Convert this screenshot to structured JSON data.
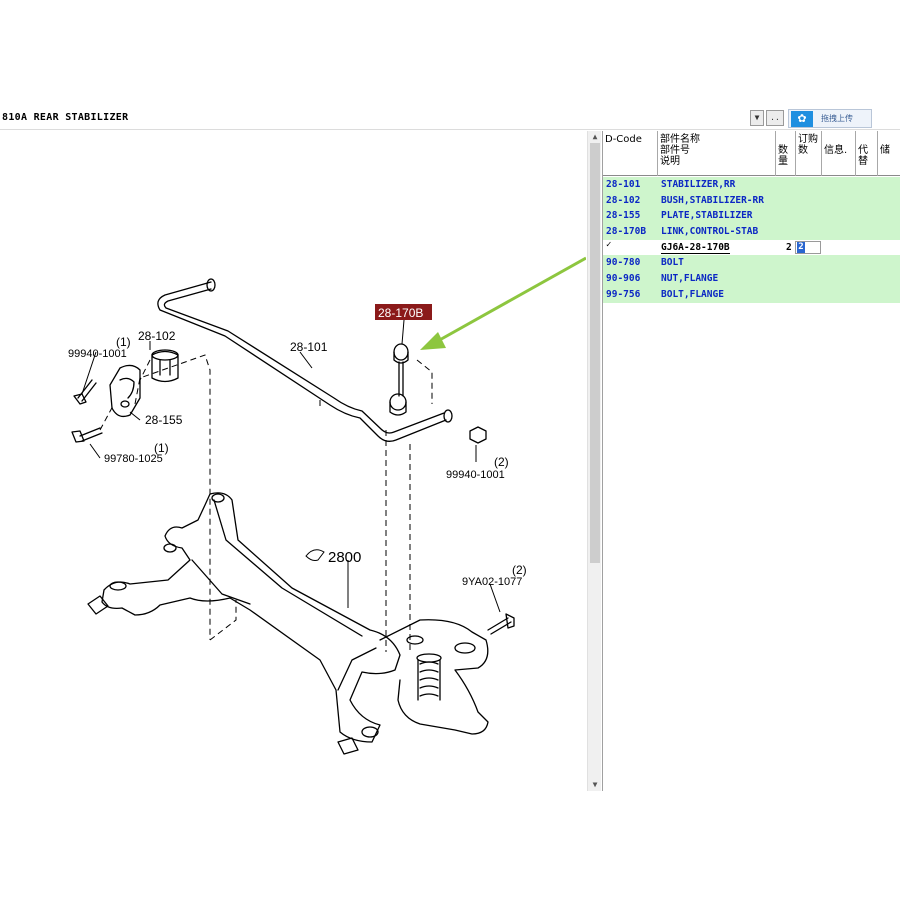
{
  "window": {
    "title": "810A  REAR STABILIZER",
    "upload_button_label": "拖拽上传",
    "upload_logo": "cloud-upload-icon"
  },
  "diagram": {
    "highlight_label": "28-170B",
    "labels": {
      "p28_102": "28-102",
      "p28_101": "28-101",
      "p28_155": "28-155",
      "p2800": "2800",
      "bolt_99940_left_qty": "(1)",
      "bolt_99940_left": "99940-1001",
      "bolt_99780_qty": "(1)",
      "bolt_99780": "99780-1025",
      "nut_99940_right_qty": "(2)",
      "nut_99940_right": "99940-1001",
      "bolt_9ya02_qty": "(2)",
      "bolt_9ya02": "9YA02-1077"
    }
  },
  "parts_table": {
    "headers": {
      "dcode": "D-Code",
      "name_l1": "部件名称",
      "name_l2": "部件号",
      "name_l3": "说明",
      "qty": "数量",
      "order_qty": "订购数",
      "info": "信息.",
      "replace": "代替",
      "extra": "储"
    },
    "rows": [
      {
        "code": "28-101",
        "name": "STABILIZER,RR"
      },
      {
        "code": "28-102",
        "name": "BUSH,STABILIZER-RR"
      },
      {
        "code": "28-155",
        "name": "PLATE,STABILIZER"
      },
      {
        "code": "28-170B",
        "name": "LINK,CONTROL-STAB"
      }
    ],
    "selected_row": {
      "checkbox": "✓",
      "part_number": "GJ6A-28-170B",
      "qty": "2",
      "order_qty": "2"
    },
    "rows_after": [
      {
        "code": "90-780",
        "name": "BOLT"
      },
      {
        "code": "90-906",
        "name": "NUT,FLANGE"
      },
      {
        "code": "99-756",
        "name": "BOLT,FLANGE"
      }
    ]
  },
  "colors": {
    "row_bg": "#cef5cc",
    "row_text": "#0b27c4",
    "highlight_label_bg": "#8b1a1a",
    "arrow": "#8dc63f"
  }
}
